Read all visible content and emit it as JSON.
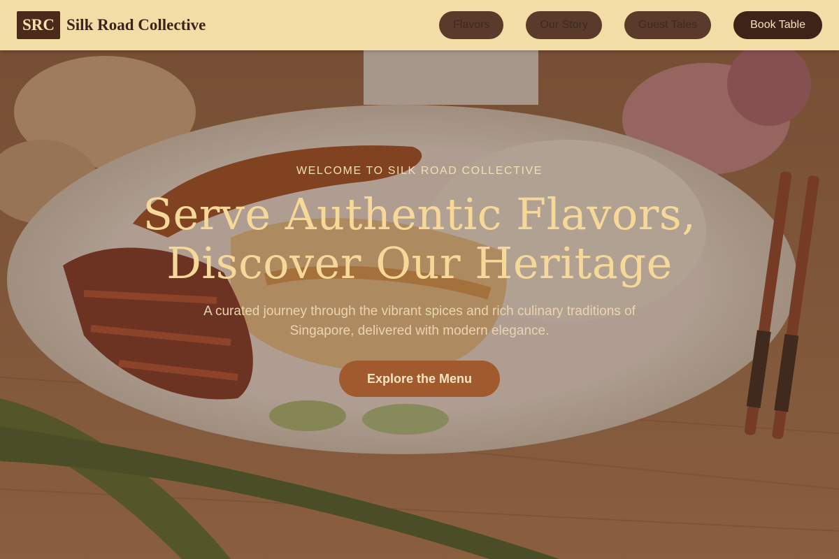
{
  "brand": {
    "logo_text": "SRC",
    "name": "Silk Road Collective"
  },
  "nav": {
    "links": [
      {
        "label": "Flavors"
      },
      {
        "label": "Our Story"
      },
      {
        "label": "Guest Tales"
      }
    ],
    "cta_label": "Book Table"
  },
  "hero": {
    "eyebrow": "WELCOME TO SILK ROAD COLLECTIVE",
    "headline_line1": "Serve Authentic Flavors,",
    "headline_line2": "Discover Our Heritage",
    "subtext": "A curated journey through the vibrant spices and rich culinary traditions of Singapore, delivered with modern elegance.",
    "cta_label": "Explore the Menu",
    "background_image": "plate of roast chicken and pork with rice, cucumber slices, chopsticks, shallots and pandan leaves on a wooden table"
  },
  "colors": {
    "nav_bg": "#f3dda7",
    "logo_bg": "#4b2a1a",
    "nav_pill_bg": "#5a3a2a",
    "cta_dark": "#3e2418",
    "headline": "#f6d998",
    "cta_main": "#a05a2e"
  }
}
